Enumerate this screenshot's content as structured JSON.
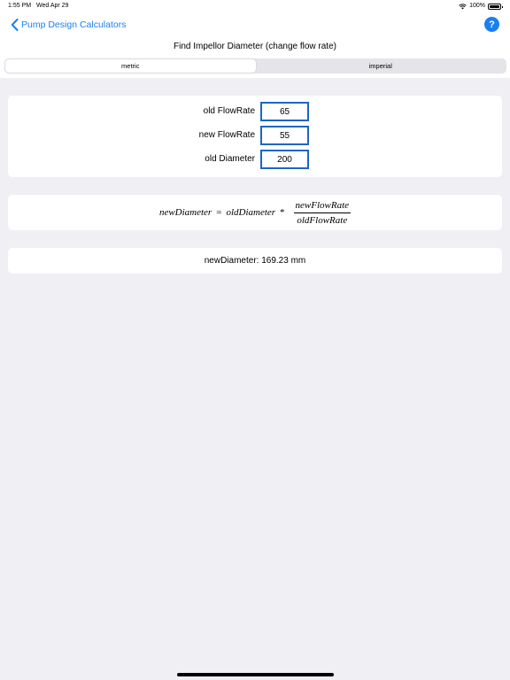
{
  "status_bar": {
    "time": "1:55 PM",
    "date": "Wed Apr 29",
    "battery": "100%"
  },
  "nav": {
    "back_label": "Pump Design Calculators",
    "help_label": "?"
  },
  "title": "Find Impellor Diameter (change flow rate)",
  "segments": {
    "metric": "metric",
    "imperial": "imperial",
    "selected": "metric"
  },
  "inputs": [
    {
      "label": "old FlowRate",
      "value": "65"
    },
    {
      "label": "new FlowRate",
      "value": "55"
    },
    {
      "label": "old Diameter",
      "value": "200"
    }
  ],
  "formula": {
    "lhs": "newDiameter",
    "equals": "=",
    "term": "oldDiameter",
    "times": "*",
    "numerator": "newFlowRate",
    "denominator": "oldFlowRate"
  },
  "result": {
    "label": "newDiameter:",
    "value": "169.23 mm"
  },
  "colors": {
    "accent": "#1a7ff2",
    "input_border": "#1c66c4",
    "background": "#efeff4"
  }
}
